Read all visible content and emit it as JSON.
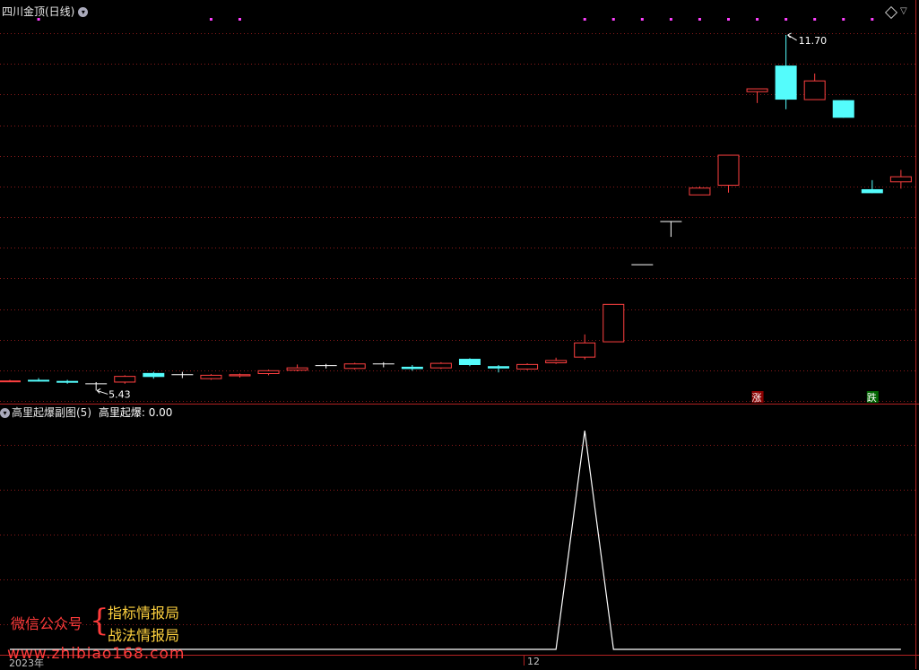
{
  "main_panel": {
    "title": "四川金顶(日线)",
    "high_label": "11.70",
    "low_label": "5.43",
    "zhang_marker": "涨",
    "die_marker": "跌"
  },
  "sub_panel": {
    "title": "高里起爆副图(5)",
    "indicator_label": "高里起爆",
    "indicator_value": "0.00"
  },
  "x_axis": {
    "year_label": "2023年",
    "month_label": "12"
  },
  "watermark": {
    "left": "微信公众号",
    "brace": "{",
    "right_top": "指标情报局",
    "right_bottom": "战法情报局",
    "url": "www.zhibiao168.com"
  },
  "colors": {
    "up": "#ff4040",
    "down": "#54fcfc",
    "flat": "#ffffff",
    "grid": "#8b1a1a",
    "line": "#ffffff",
    "dot": "#ff40ff"
  },
  "chart_data": [
    {
      "type": "candlestick",
      "title": "四川金顶(日线)",
      "price_range": [
        5.2,
        12.0
      ],
      "annotated_high": 11.7,
      "annotated_low": 5.43,
      "candles": [
        {
          "open": 5.6,
          "close": 5.6,
          "high": 5.62,
          "low": 5.58,
          "dir": "up"
        },
        {
          "open": 5.62,
          "close": 5.62,
          "high": 5.65,
          "low": 5.59,
          "dir": "down"
        },
        {
          "open": 5.6,
          "close": 5.57,
          "high": 5.62,
          "low": 5.55,
          "dir": "down"
        },
        {
          "open": 5.55,
          "close": 5.55,
          "high": 5.58,
          "low": 5.43,
          "dir": "flat"
        },
        {
          "open": 5.58,
          "close": 5.68,
          "high": 5.7,
          "low": 5.55,
          "dir": "up"
        },
        {
          "open": 5.74,
          "close": 5.67,
          "high": 5.76,
          "low": 5.64,
          "dir": "down"
        },
        {
          "open": 5.71,
          "close": 5.71,
          "high": 5.76,
          "low": 5.65,
          "dir": "flat"
        },
        {
          "open": 5.64,
          "close": 5.7,
          "high": 5.72,
          "low": 5.62,
          "dir": "up"
        },
        {
          "open": 5.69,
          "close": 5.71,
          "high": 5.73,
          "low": 5.66,
          "dir": "up"
        },
        {
          "open": 5.73,
          "close": 5.78,
          "high": 5.8,
          "low": 5.7,
          "dir": "up"
        },
        {
          "open": 5.79,
          "close": 5.83,
          "high": 5.89,
          "low": 5.77,
          "dir": "up"
        },
        {
          "open": 5.87,
          "close": 5.87,
          "high": 5.9,
          "low": 5.82,
          "dir": "flat"
        },
        {
          "open": 5.82,
          "close": 5.9,
          "high": 5.92,
          "low": 5.8,
          "dir": "up"
        },
        {
          "open": 5.9,
          "close": 5.9,
          "high": 5.93,
          "low": 5.84,
          "dir": "flat"
        },
        {
          "open": 5.85,
          "close": 5.81,
          "high": 5.88,
          "low": 5.78,
          "dir": "down"
        },
        {
          "open": 5.83,
          "close": 5.91,
          "high": 5.93,
          "low": 5.81,
          "dir": "up"
        },
        {
          "open": 5.99,
          "close": 5.88,
          "high": 6.0,
          "low": 5.86,
          "dir": "down"
        },
        {
          "open": 5.86,
          "close": 5.82,
          "high": 5.88,
          "low": 5.75,
          "dir": "down"
        },
        {
          "open": 5.81,
          "close": 5.89,
          "high": 5.91,
          "low": 5.79,
          "dir": "up"
        },
        {
          "open": 5.92,
          "close": 5.96,
          "high": 6.01,
          "low": 5.9,
          "dir": "up"
        },
        {
          "open": 6.02,
          "close": 6.27,
          "high": 6.42,
          "low": 5.98,
          "dir": "up"
        },
        {
          "open": 6.29,
          "close": 6.95,
          "high": 6.95,
          "low": 6.29,
          "dir": "up"
        },
        {
          "open": 7.65,
          "close": 7.65,
          "high": 7.65,
          "low": 7.65,
          "dir": "flat"
        },
        {
          "open": 8.41,
          "close": 8.41,
          "high": 8.41,
          "low": 8.14,
          "dir": "flat"
        },
        {
          "open": 8.88,
          "close": 9.0,
          "high": 9.03,
          "low": 8.88,
          "dir": "up"
        },
        {
          "open": 9.05,
          "close": 9.58,
          "high": 9.58,
          "low": 8.92,
          "dir": "up"
        },
        {
          "open": 10.7,
          "close": 10.75,
          "high": 10.75,
          "low": 10.5,
          "dir": "up"
        },
        {
          "open": 11.16,
          "close": 10.56,
          "high": 11.7,
          "low": 10.39,
          "dir": "down"
        },
        {
          "open": 10.56,
          "close": 10.89,
          "high": 11.02,
          "low": 10.56,
          "dir": "up"
        },
        {
          "open": 10.55,
          "close": 10.24,
          "high": 10.55,
          "low": 10.24,
          "dir": "down"
        },
        {
          "open": 8.98,
          "close": 8.91,
          "high": 9.14,
          "low": 8.91,
          "dir": "down"
        },
        {
          "open": 9.11,
          "close": 9.2,
          "high": 9.32,
          "low": 8.99,
          "dir": "up"
        }
      ],
      "markers": [
        {
          "candle": 26,
          "label": "涨"
        },
        {
          "candle": 30,
          "label": "跌"
        }
      ],
      "signal_dots": [
        1,
        7,
        8,
        20,
        21,
        22,
        23,
        24,
        25,
        26,
        27,
        28,
        29,
        30
      ]
    },
    {
      "type": "line",
      "title": "高里起爆副图(5)",
      "series": [
        {
          "name": "高里起爆",
          "values": [
            0,
            0,
            0,
            0,
            0,
            0,
            0,
            0,
            0,
            0,
            0,
            0,
            0,
            0,
            0,
            0,
            0,
            0,
            0,
            0,
            1,
            0,
            0,
            0,
            0,
            0,
            0,
            0,
            0,
            0,
            0,
            0
          ]
        }
      ],
      "ylim": [
        0,
        1.05
      ]
    }
  ]
}
